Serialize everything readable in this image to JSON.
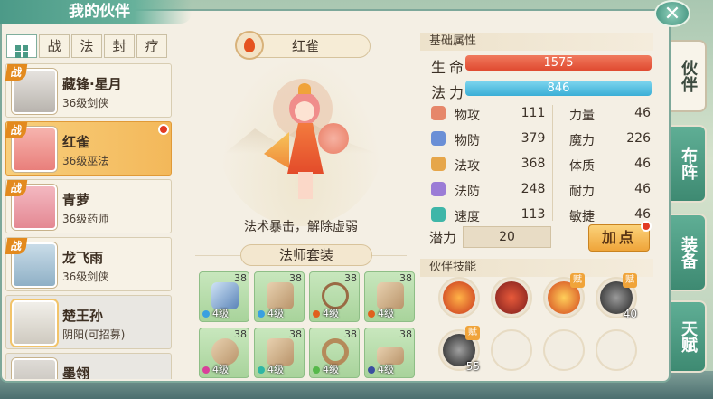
{
  "window": {
    "title": "我的伙伴",
    "close_icon": "close-icon"
  },
  "filters": {
    "all_icon": "grid-icon",
    "items": [
      "战",
      "法",
      "封",
      "疗"
    ]
  },
  "roster": [
    {
      "name": "藏锋·星月",
      "info": "36级剑侠",
      "badge": "战",
      "selected": false,
      "red_dot": false
    },
    {
      "name": "红雀",
      "info": "36级巫法",
      "badge": "战",
      "selected": true,
      "red_dot": true
    },
    {
      "name": "青萝",
      "info": "36级药师",
      "badge": "战",
      "selected": false,
      "red_dot": false
    },
    {
      "name": "龙飞雨",
      "info": "36级剑侠",
      "badge": "战",
      "selected": false,
      "red_dot": false
    },
    {
      "name": "楚王孙",
      "info": "阴阳(可招募)",
      "badge": "",
      "selected": false,
      "red_dot": false
    },
    {
      "name": "墨翎",
      "info": "",
      "badge": "",
      "selected": false,
      "red_dot": false
    }
  ],
  "hero": {
    "name": "红雀",
    "element_icon": "fire-icon",
    "description": "法术暴击，解除虚弱",
    "set_label": "法师套装"
  },
  "equipment": [
    {
      "level_badge": "38",
      "level_text": "4级",
      "icon": "sword-icon",
      "gem_color": "#3aa0e0"
    },
    {
      "level_badge": "38",
      "level_text": "4级",
      "icon": "hat-icon",
      "gem_color": "#3aa0e0"
    },
    {
      "level_badge": "38",
      "level_text": "4级",
      "icon": "necklace-icon",
      "gem_color": "#e0601e"
    },
    {
      "level_badge": "38",
      "level_text": "4级",
      "icon": "armor-icon",
      "gem_color": "#e0601e"
    },
    {
      "level_badge": "38",
      "level_text": "4级",
      "icon": "belt-icon",
      "gem_color": "#d9409a"
    },
    {
      "level_badge": "38",
      "level_text": "4级",
      "icon": "bracer-icon",
      "gem_color": "#2fb6a4"
    },
    {
      "level_badge": "38",
      "level_text": "4级",
      "icon": "ring-icon",
      "gem_color": "#56b84a"
    },
    {
      "level_badge": "38",
      "level_text": "4级",
      "icon": "shoes-icon",
      "gem_color": "#3a4fa0"
    }
  ],
  "basic": {
    "heading": "基础属性",
    "hp": {
      "label": "生命",
      "value": "1575",
      "color": "#e8553b"
    },
    "mp": {
      "label": "法力",
      "value": "846",
      "color": "#4fb8e0"
    },
    "stats_left": [
      {
        "name": "物攻",
        "value": "111",
        "icon": "sword-icon"
      },
      {
        "name": "物防",
        "value": "379",
        "icon": "shield-icon"
      },
      {
        "name": "法攻",
        "value": "368",
        "icon": "wand-icon"
      },
      {
        "name": "法防",
        "value": "248",
        "icon": "magic-shield-icon"
      },
      {
        "name": "速度",
        "value": "113",
        "icon": "speed-icon"
      }
    ],
    "stats_right": [
      {
        "name": "力量",
        "value": "46"
      },
      {
        "name": "魔力",
        "value": "226"
      },
      {
        "name": "体质",
        "value": "46"
      },
      {
        "name": "耐力",
        "value": "46"
      },
      {
        "name": "敏捷",
        "value": "46"
      }
    ],
    "potential_label": "潜力",
    "potential_value": "20",
    "add_point_label": "加点"
  },
  "skills": {
    "heading": "伙伴技能",
    "items": [
      {
        "icon": "fire-burst-icon",
        "fu": "",
        "count": ""
      },
      {
        "icon": "phoenix-icon",
        "fu": "",
        "count": ""
      },
      {
        "icon": "flame-strike-icon",
        "fu": "赋",
        "count": ""
      },
      {
        "icon": "dark-slash-icon",
        "fu": "赋",
        "count": "40"
      },
      {
        "icon": "dark-slash-icon",
        "fu": "赋",
        "count": "55"
      },
      {
        "icon": "",
        "fu": "",
        "count": ""
      },
      {
        "icon": "",
        "fu": "",
        "count": ""
      },
      {
        "icon": "",
        "fu": "",
        "count": ""
      }
    ]
  },
  "side_tabs": [
    "伙伴",
    "布阵",
    "装备",
    "天赋"
  ]
}
